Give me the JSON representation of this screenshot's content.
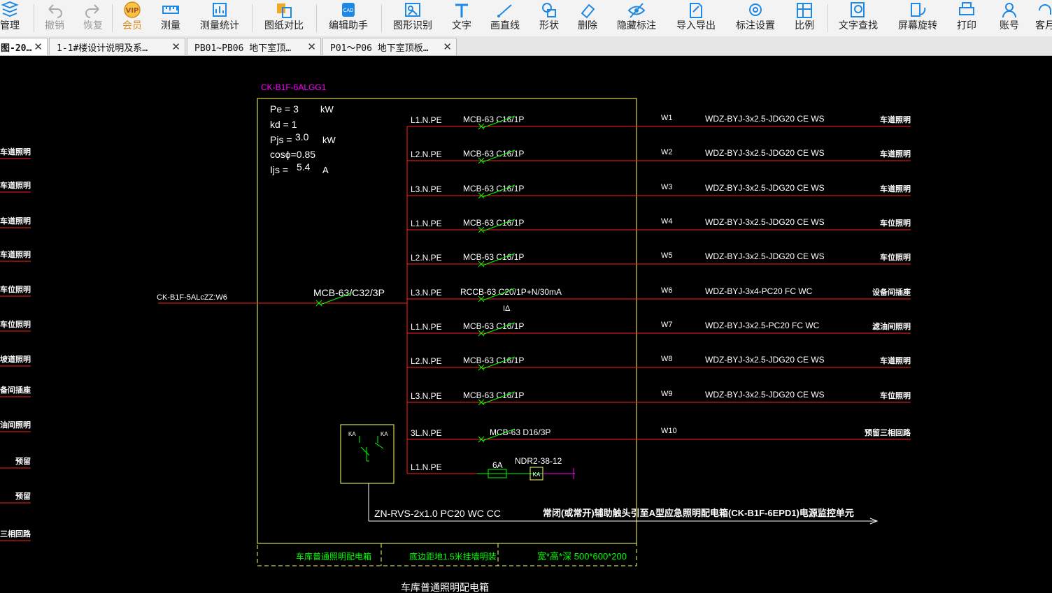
{
  "toolbar": {
    "items": [
      {
        "label": "管理",
        "icon": "layers-icon"
      },
      {
        "label": "撤销",
        "icon": "undo-icon"
      },
      {
        "label": "恢复",
        "icon": "redo-icon"
      },
      {
        "label": "会员",
        "icon": "vip-icon"
      },
      {
        "label": "测量",
        "icon": "ruler-icon"
      },
      {
        "label": "测量统计",
        "icon": "measure-stats-icon"
      },
      {
        "label": "图纸对比",
        "icon": "compare-icon"
      },
      {
        "label": "编辑助手",
        "icon": "cad-edit-icon"
      },
      {
        "label": "图形识别",
        "icon": "shape-recognize-icon"
      },
      {
        "label": "文字",
        "icon": "text-icon"
      },
      {
        "label": "画直线",
        "icon": "line-icon"
      },
      {
        "label": "形状",
        "icon": "shape-icon"
      },
      {
        "label": "删除",
        "icon": "eraser-icon"
      },
      {
        "label": "隐藏标注",
        "icon": "eye-hide-icon"
      },
      {
        "label": "导入导出",
        "icon": "import-export-icon"
      },
      {
        "label": "标注设置",
        "icon": "annotation-settings-icon"
      },
      {
        "label": "比例",
        "icon": "scale-icon"
      },
      {
        "label": "文字查找",
        "icon": "text-search-icon"
      },
      {
        "label": "屏幕旋转",
        "icon": "rotate-screen-icon"
      },
      {
        "label": "打印",
        "icon": "printer-icon"
      },
      {
        "label": "账号",
        "icon": "account-icon"
      },
      {
        "label": "客月",
        "icon": "service-icon"
      }
    ]
  },
  "tabs": [
    {
      "label": "图-20…",
      "active": true
    },
    {
      "label": "1-1#楼设计说明及系…",
      "active": false
    },
    {
      "label": "PB01~PB06 地下室顶…",
      "active": false
    },
    {
      "label": "P01～P06 地下室顶板…",
      "active": false
    }
  ],
  "colors": {
    "wire": "#ff2020",
    "breaker": "#00ff00",
    "frame": "#ffff66",
    "label": "#ffffff",
    "magenta": "#ff00ff",
    "load_label": "#ffffff"
  },
  "drawing": {
    "panel_id": "CK-B1F-6ALGG1",
    "params": {
      "pe": "Pe = 3",
      "pe_unit": "kW",
      "kd": "kd = 1",
      "pjs_label": "Pjs =",
      "pjs_value": "3.0",
      "pjs_unit": "kW",
      "cos": "cosϕ=0.85",
      "ijs_label": "Ijs =",
      "ijs_value": "5.4",
      "ijs_unit": "A"
    },
    "incoming": {
      "source": "CK-B1F-5ALcZZ:W6",
      "breaker": "MCB-63/C32/3P"
    },
    "circuits": [
      {
        "phase": "L1.N.PE",
        "breaker": "MCB-63  C16/1P",
        "id": "W1",
        "cable": "WDZ-BYJ-3x2.5-JDG20  CE  WS",
        "load": "车道照明"
      },
      {
        "phase": "L2.N.PE",
        "breaker": "MCB-63  C16/1P",
        "id": "W2",
        "cable": "WDZ-BYJ-3x2.5-JDG20  CE  WS",
        "load": "车道照明"
      },
      {
        "phase": "L3.N.PE",
        "breaker": "MCB-63  C16/1P",
        "id": "W3",
        "cable": "WDZ-BYJ-3x2.5-JDG20  CE  WS",
        "load": "车道照明"
      },
      {
        "phase": "L1.N.PE",
        "breaker": "MCB-63  C16/1P",
        "id": "W4",
        "cable": "WDZ-BYJ-3x2.5-JDG20  CE  WS",
        "load": "车位照明"
      },
      {
        "phase": "L2.N.PE",
        "breaker": "MCB-63  C16/1P",
        "id": "W5",
        "cable": "WDZ-BYJ-3x2.5-JDG20  CE  WS",
        "load": "车位照明"
      },
      {
        "phase": "L3.N.PE",
        "breaker": "RCCB-63  C20/1P+N/30mA",
        "id": "W6",
        "cable": "WDZ-BYJ-3x4-PC20  FC  WC",
        "load": "设备间插座"
      },
      {
        "phase": "L1.N.PE",
        "breaker": "MCB-63  C16/1P",
        "id": "W7",
        "cable": "WDZ-BYJ-3x2.5-PC20  FC  WC",
        "load": "滤油间照明"
      },
      {
        "phase": "L2.N.PE",
        "breaker": "MCB-63  C16/1P",
        "id": "W8",
        "cable": "WDZ-BYJ-3x2.5-JDG20  CE  WS",
        "load": "车道照明"
      },
      {
        "phase": "L3.N.PE",
        "breaker": "MCB-63  C16/1P",
        "id": "W9",
        "cable": "WDZ-BYJ-3x2.5-JDG20  CE  WS",
        "load": "车位照明"
      },
      {
        "phase": "3L.N.PE",
        "breaker": "MCB-63  D16/3P",
        "id": "W10",
        "cable": "",
        "load": "预留三相回路"
      },
      {
        "phase": "L1.N.PE",
        "breaker": "",
        "id": "",
        "cable": "",
        "load": ""
      }
    ],
    "rccb_mark": "IΔ",
    "fuse_label": "6A",
    "relay_label": "NDR2-38-12",
    "ka_label": "KA",
    "control_cable": "ZN-RVS-2x1.0  PC20  WC  CC",
    "control_note": "常闭(或常开)辅助触头引至A型应急照明配电箱(CK-B1F-6EPD1)电源监控单元",
    "footer": [
      "车库普通照明配电箱",
      "底边距地1.5米挂墙明装",
      "宽*高*深  500*600*200"
    ],
    "caption": "车库普通照明配电箱",
    "left_loads": [
      "车道照明",
      "车道照明",
      "车道照明",
      "车道照明",
      "车位照明",
      "车位照明",
      "坡道照明",
      "设备间插座",
      "滤油间照明",
      "预留",
      "预留",
      "预留三相回路"
    ]
  }
}
